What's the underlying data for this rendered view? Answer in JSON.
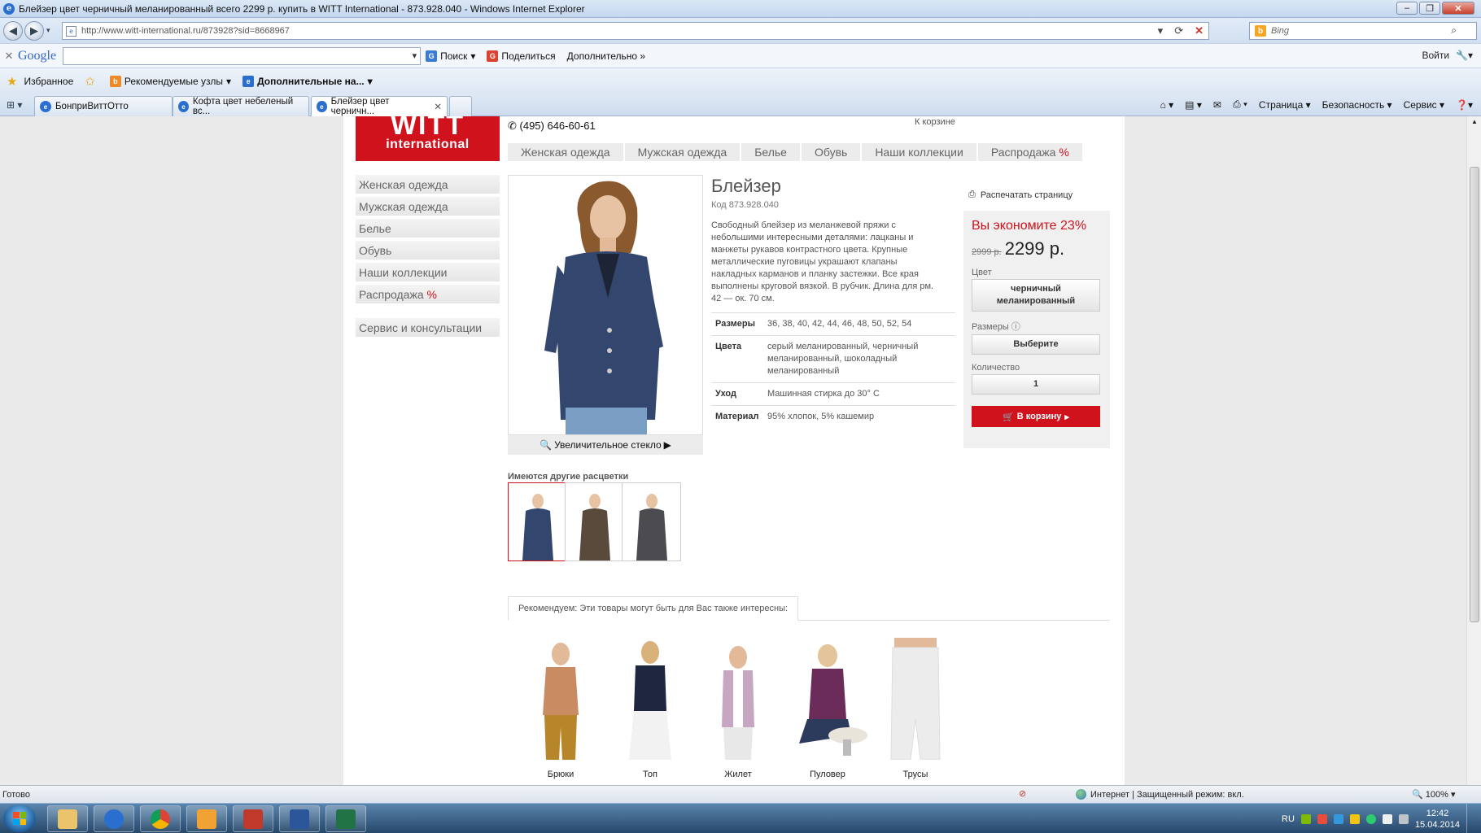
{
  "window": {
    "title": "Блейзер цвет черничный меланированный всего 2299 р. купить в WITT International - 873.928.040 - Windows Internet Explorer",
    "url": "http://www.witt-international.ru/873928?sid=8668967",
    "bing_placeholder": "Bing"
  },
  "google_toolbar": {
    "logo": "Google",
    "search_label": "Поиск",
    "share_label": "Поделиться",
    "more_label": "Дополнительно »",
    "signin_label": "Войти"
  },
  "favorites_bar": {
    "favorites_label": "Избранное",
    "suggested_label": "Рекомендуемые узлы",
    "addons_label": "Дополнительные на..."
  },
  "tabs": [
    {
      "label": "БонприВиттОтто"
    },
    {
      "label": "Кофта цвет небеленый вс..."
    },
    {
      "label": "Блейзер цвет черничн..."
    }
  ],
  "command_bar": {
    "page_label": "Страница",
    "safety_label": "Безопасность",
    "tools_label": "Сервис"
  },
  "site": {
    "logo_top": "WITT",
    "logo_bottom": "international",
    "phone": "(495) 646-60-61",
    "to_cart": "К корзине",
    "top_nav": [
      "Женская одежда",
      "Мужская одежда",
      "Белье",
      "Обувь",
      "Наши коллекции",
      "Распродажа"
    ],
    "sale_symbol": "%",
    "left_nav": [
      "Женская одежда",
      "Мужская одежда",
      "Белье",
      "Обувь",
      "Наши коллекции",
      "Распродажа"
    ],
    "service_link": "Сервис и консультации"
  },
  "product": {
    "title": "Блейзер",
    "code": "Код 873.928.040",
    "description": "Свободный блейзер из меланжевой пряжи с небольшими интересными деталями: лацканы и манжеты рукавов контрастного цвета. Крупные металлические пуговицы украшают клапаны накладных карманов и планку застежки. Все края выполнены круговой вязкой. В рубчик. Длина для рм. 42 — ок. 70 см.",
    "specs": [
      {
        "key": "Размеры",
        "value": "36, 38, 40, 42, 44, 46, 48, 50, 52, 54"
      },
      {
        "key": "Цвета",
        "value": "серый меланированный, черничный меланированный, шоколадный меланированный"
      },
      {
        "key": "Уход",
        "value": "Машинная стирка до 30° C"
      },
      {
        "key": "Материал",
        "value": "95% хлопок, 5% кашемир"
      }
    ],
    "magnify_label": "Увеличительное стекло",
    "print_label": "Распечатать страницу",
    "save_text": "Вы экономите 23%",
    "old_price": "2999 р.",
    "new_price": "2299 р.",
    "color_label": "Цвет",
    "color_value": "черничный меланированный",
    "size_label": "Размеры",
    "size_value": "Выберите",
    "qty_label": "Количество",
    "qty_value": "1",
    "cart_button": "В корзину",
    "variants_title": "Имеются другие расцветки",
    "variant_colors": [
      "#33466e",
      "#5a4a3c",
      "#4b4b50"
    ]
  },
  "recommend": {
    "title": "Рекомендуем: Эти товары могут быть для Вас также интересны:",
    "items": [
      {
        "name": "Брюки",
        "color": "#b8642e"
      },
      {
        "name": "Топ",
        "color": "#1f2740"
      },
      {
        "name": "Жилет",
        "color": "#c6a6c0"
      },
      {
        "name": "Пуловер",
        "color": "#6b2c5a"
      },
      {
        "name": "Трусы",
        "color": "#e9e9e9"
      }
    ]
  },
  "statusbar": {
    "status": "Готово",
    "zone": "Интернет | Защищенный режим: вкл.",
    "zoom": "100%"
  },
  "taskbar": {
    "lang": "RU",
    "time": "12:42",
    "date": "15.04.2014"
  },
  "colors": {
    "brand_red": "#d0121c"
  }
}
